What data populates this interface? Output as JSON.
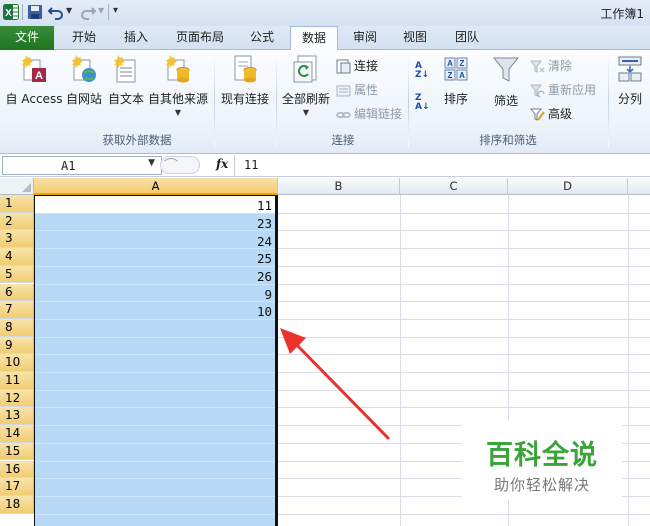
{
  "titlebar": {
    "title": "工作簿1",
    "qat": [
      "save-icon",
      "undo-icon",
      "redo-icon",
      "customize-icon"
    ]
  },
  "tabs": [
    {
      "label": "文件",
      "kind": "file"
    },
    {
      "label": "开始"
    },
    {
      "label": "插入"
    },
    {
      "label": "页面布局"
    },
    {
      "label": "公式"
    },
    {
      "label": "数据",
      "active": true
    },
    {
      "label": "审阅"
    },
    {
      "label": "视图"
    },
    {
      "label": "团队"
    }
  ],
  "ribbon": {
    "get_external": {
      "label": "获取外部数据",
      "from_access": "自 Access",
      "from_web": "自网站",
      "from_text": "自文本",
      "from_other": "自其他来源",
      "existing": "现有连接"
    },
    "connections": {
      "label": "连接",
      "refresh_all": "全部刷新",
      "connections": "连接",
      "properties": "属性",
      "edit_links": "编辑链接"
    },
    "sort_filter": {
      "label": "排序和筛选",
      "sort": "排序",
      "filter": "筛选",
      "clear": "清除",
      "reapply": "重新应用",
      "advanced": "高级"
    },
    "data_tools": {
      "text_to_columns": "分列"
    }
  },
  "formula_bar": {
    "name_box": "A1",
    "fx": "fx",
    "value": "11"
  },
  "sheet": {
    "columns": [
      "A",
      "B",
      "C",
      "D"
    ],
    "rows": [
      "1",
      "2",
      "3",
      "4",
      "5",
      "6",
      "7",
      "8",
      "9",
      "10",
      "11",
      "12",
      "13",
      "14",
      "15",
      "16",
      "17",
      "18"
    ],
    "column_a_values": [
      "11",
      "23",
      "24",
      "25",
      "26",
      "9",
      "10"
    ]
  },
  "watermark": {
    "title": "百科全说",
    "subtitle": "助你轻松解决"
  },
  "colors": {
    "file_tab": "#2a7f2b",
    "selection_fill": "#b8d9f5",
    "annotation_arrow": "#e8322b",
    "watermark_green": "#3aa33a"
  }
}
